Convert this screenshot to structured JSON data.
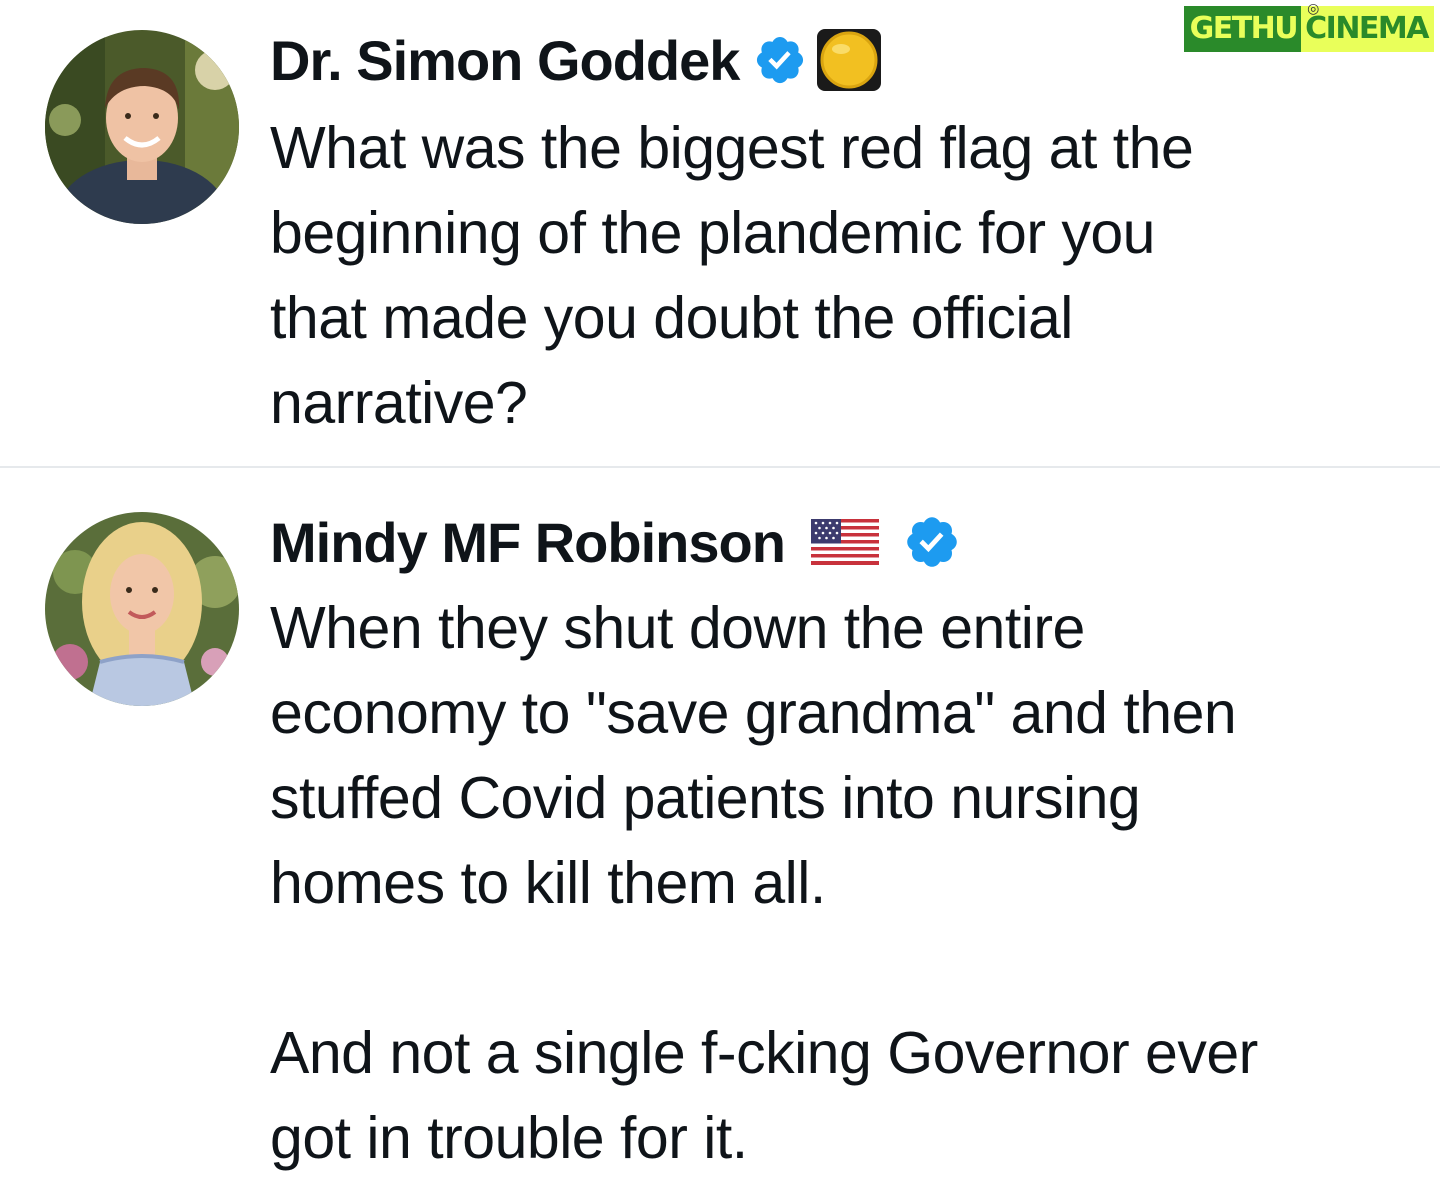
{
  "watermark": {
    "left_text": "GETHU",
    "right_text": "CINEMA"
  },
  "tweets": [
    {
      "author": "Dr. Simon Goddek",
      "verified_icon": "verified-badge-icon",
      "extra_icon": "yellow-circle-emoji",
      "text": "What was the biggest red flag at the\nbeginning of the plandemic for you\nthat made you doubt the official\nnarrative?"
    },
    {
      "author": "Mindy MF Robinson",
      "flag_icon": "us-flag-emoji",
      "verified_icon": "verified-badge-icon",
      "text": "When they shut down the entire\neconomy to \"save grandma\" and then\nstuffed Covid patients into nursing\nhomes to kill them all.\n\nAnd not a single f-cking Governor ever\ngot in trouble for it."
    }
  ],
  "colors": {
    "verified_blue": "#1d9bf0",
    "divider": "#e6e9ec",
    "text": "#0f1419"
  }
}
